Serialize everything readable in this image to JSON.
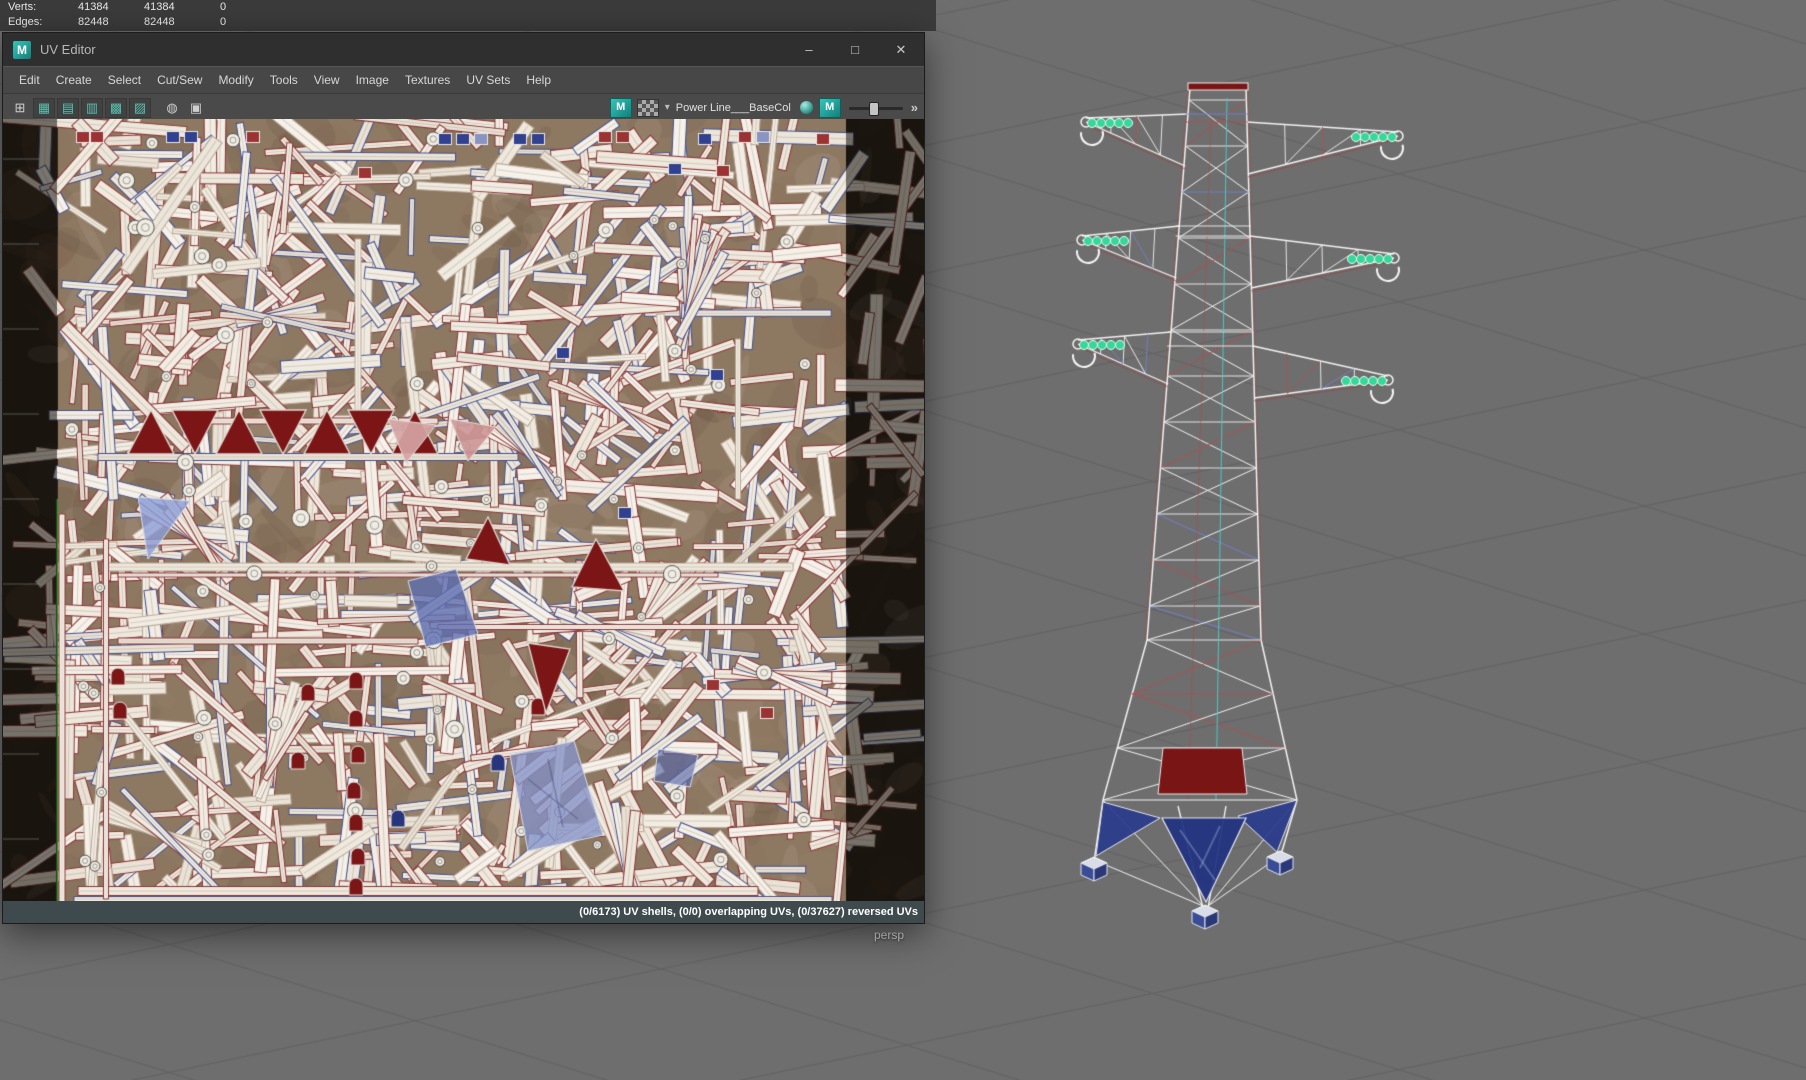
{
  "hud": {
    "rows": [
      {
        "label": "Verts:",
        "v1": "41384",
        "v2": "41384",
        "v3": "0"
      },
      {
        "label": "Edges:",
        "v1": "82448",
        "v2": "82448",
        "v3": "0"
      }
    ]
  },
  "window": {
    "title": "UV Editor",
    "controls": {
      "minimize": "–",
      "maximize": "□",
      "close": "✕"
    }
  },
  "menus": [
    {
      "label": "Edit"
    },
    {
      "label": "Create"
    },
    {
      "label": "Select"
    },
    {
      "label": "Cut/Sew"
    },
    {
      "label": "Modify"
    },
    {
      "label": "Tools"
    },
    {
      "label": "View"
    },
    {
      "label": "Image"
    },
    {
      "label": "Textures"
    },
    {
      "label": "UV Sets"
    },
    {
      "label": "Help"
    }
  ],
  "toolbar": {
    "texture_label": "Power Line___BaseCol",
    "icons": {
      "maya": "M",
      "grid_layout": "⊞",
      "uv_border": "▦",
      "uv_shaded": "▤",
      "uv_texture": "▥",
      "uv_distortion": "▩",
      "uv_checker": "▨",
      "shader_ball": "◍",
      "snapshot": "▣",
      "dropdown": "▾",
      "expand": "»"
    }
  },
  "statusbar": {
    "text": "(0/6173) UV shells, (0/0) overlapping UVs, (0/37627) reversed UVs"
  },
  "viewport": {
    "camera_label": "persp"
  },
  "colors": {
    "viewport_bg": "#6e6e6e",
    "grid_line": "#626262",
    "titlebar_bg": "#2f2f2f",
    "menubar_bg": "#474747",
    "toolbar_bg": "#4a4a4a",
    "statusbar_bg": "#3e4a4d",
    "accent_teal": "#58c0b0",
    "maya_teal": "#28a8a0"
  },
  "uv_map": {
    "seed": 7,
    "strip_count": 700,
    "circle_count": 85,
    "palette": {
      "shell_fill": "#f1ebe2",
      "edge_red": "#8a3434",
      "edge_blue": "#41508f",
      "edge_tan": "#b9a795",
      "dark_red": "#7c1616",
      "pink": "#d4a0a0",
      "blue_panel": "#5a6cb0",
      "bg": "#8d7862"
    }
  },
  "tower": {
    "insulator_green": "#35d89a",
    "wire_white": "#f2f2f2",
    "accent_red": "#b05050",
    "accent_blue": "#7080d0",
    "panel_blue": "#2c3f8f",
    "panel_red": "#7a1515"
  }
}
